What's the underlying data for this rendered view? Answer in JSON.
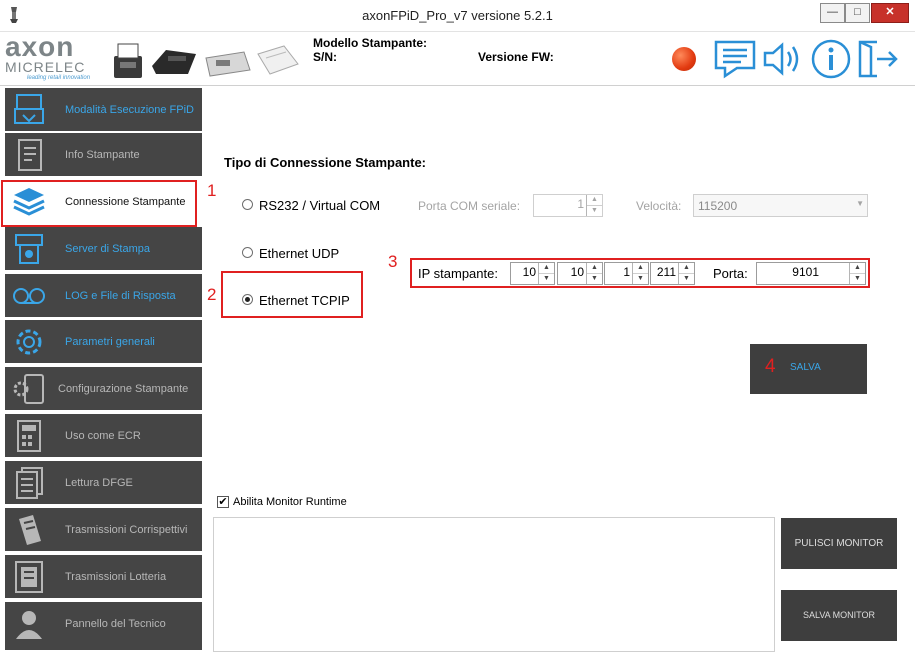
{
  "window": {
    "title": "axonFPiD_Pro_v7 versione 5.2.1",
    "minimize": "—",
    "maximize": "□",
    "close": "✕"
  },
  "header": {
    "logo_top": "axon",
    "logo_bottom": "MICRELEC",
    "logo_tagline": "leading retail innovation",
    "model_label": "Modello Stampante:",
    "sn_label": "S/N:",
    "fw_label": "Versione FW:",
    "status_color": "#e23a10",
    "icons": [
      "chat-icon",
      "speaker-icon",
      "info-icon",
      "exit-icon"
    ]
  },
  "sidebar": {
    "items": [
      {
        "label": "Modalità Esecuzione FPiD",
        "icon": "fpid-mode-icon",
        "style": "blue"
      },
      {
        "label": "Info Stampante",
        "icon": "document-icon",
        "style": "grey"
      },
      {
        "label": "Connessione Stampante",
        "icon": "layers-icon",
        "style": "active"
      },
      {
        "label": "Server di Stampa",
        "icon": "print-server-icon",
        "style": "blue"
      },
      {
        "label": "LOG e File di Risposta",
        "icon": "tape-icon",
        "style": "blue"
      },
      {
        "label": "Parametri generali",
        "icon": "gear-icon",
        "style": "blue"
      },
      {
        "label": "Configurazione Stampante",
        "icon": "printer-config-icon",
        "style": "grey"
      },
      {
        "label": "Uso come ECR",
        "icon": "calculator-icon",
        "style": "grey"
      },
      {
        "label": "Lettura DFGE",
        "icon": "documents-icon",
        "style": "grey"
      },
      {
        "label": "Trasmissioni Corrispettivi",
        "icon": "transmission-icon",
        "style": "grey"
      },
      {
        "label": "Trasmissioni Lotteria",
        "icon": "receipt-icon",
        "style": "grey"
      },
      {
        "label": "Pannello del Tecnico",
        "icon": "user-icon",
        "style": "grey"
      }
    ]
  },
  "connection": {
    "title": "Tipo di Connessione Stampante:",
    "rs232_label": "RS232 / Virtual COM",
    "com_port_label": "Porta COM seriale:",
    "com_port_value": "1",
    "speed_label": "Velocità:",
    "speed_value": "115200",
    "udp_label": "Ethernet UDP",
    "tcpip_label": "Ethernet TCPIP",
    "selected": "tcpip",
    "ip_label": "IP stampante:",
    "ip": [
      "10",
      "10",
      "1",
      "211"
    ],
    "port_label": "Porta:",
    "port_value": "9101",
    "save_label": "SALVA"
  },
  "annotations": [
    "1",
    "2",
    "3",
    "4"
  ],
  "monitor": {
    "enable_label": "Abilita Monitor Runtime",
    "enabled": true,
    "clear_label": "PULISCI MONITOR",
    "save_label": "SALVA MONITOR"
  }
}
